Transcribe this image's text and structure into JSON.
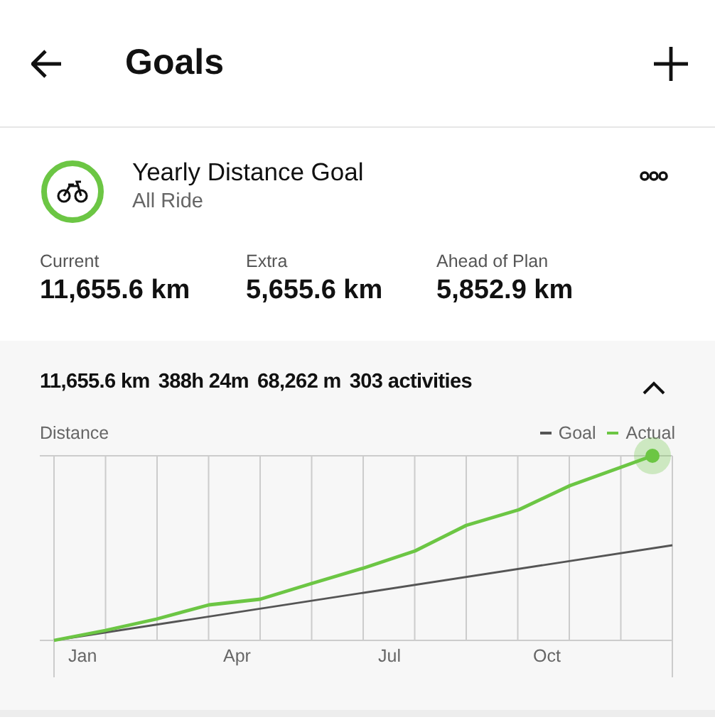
{
  "header": {
    "title": "Goals"
  },
  "goal": {
    "title": "Yearly Distance Goal",
    "subtitle": "All Ride"
  },
  "stats": [
    {
      "label": "Current",
      "value": "11,655.6 km"
    },
    {
      "label": "Extra",
      "value": "5,655.6 km"
    },
    {
      "label": "Ahead of Plan",
      "value": "5,852.9 km"
    }
  ],
  "summary": {
    "items": [
      "11,655.6 km",
      "388h 24m",
      "68,262 m",
      "303 activities"
    ],
    "expanded": true
  },
  "chart": {
    "ylabel": "Distance",
    "legend": [
      {
        "name": "Goal",
        "color": "#555555"
      },
      {
        "name": "Actual",
        "color": "#6cc644"
      }
    ],
    "months": [
      "Jan",
      "Apr",
      "Jul",
      "Oct"
    ]
  }
}
